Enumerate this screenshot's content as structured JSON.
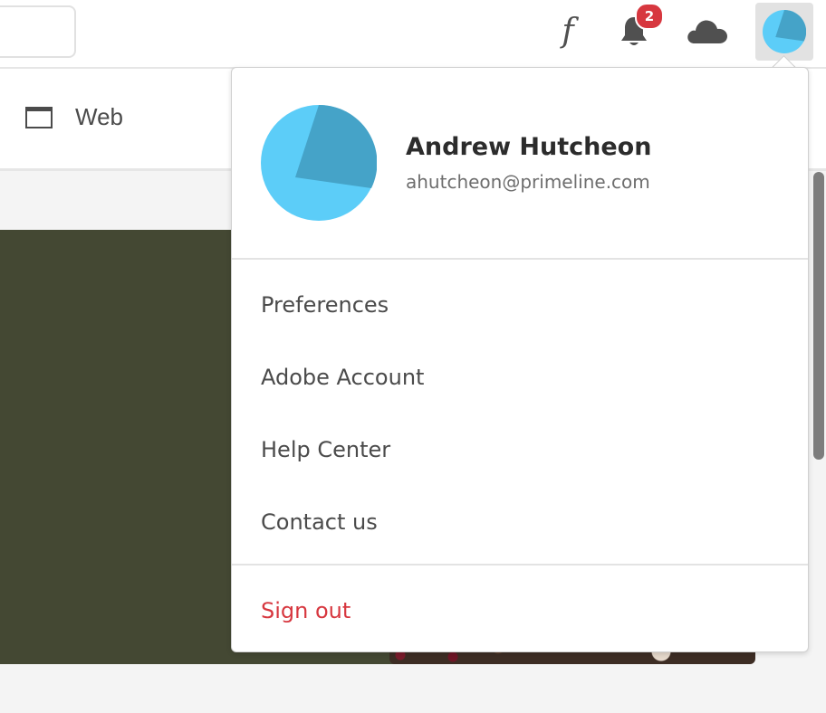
{
  "topbar": {
    "fonts_glyph": "f",
    "notifications_count": "2",
    "icons": [
      "search-box",
      "fonts-icon",
      "bell-icon",
      "cloud-icon",
      "avatar"
    ]
  },
  "subbar": {
    "web_label": "Web"
  },
  "user": {
    "name": "Andrew Hutcheon",
    "email": "ahutcheon@primeline.com"
  },
  "menu": {
    "items": [
      "Preferences",
      "Adobe Account",
      "Help Center",
      "Contact us"
    ],
    "sign_out": "Sign out"
  },
  "colors": {
    "avatar_light": "#5ccdf8",
    "avatar_dark": "#45a3c8",
    "badge": "#d7373f",
    "sign_out": "#d7373f",
    "hero": "#444833"
  }
}
